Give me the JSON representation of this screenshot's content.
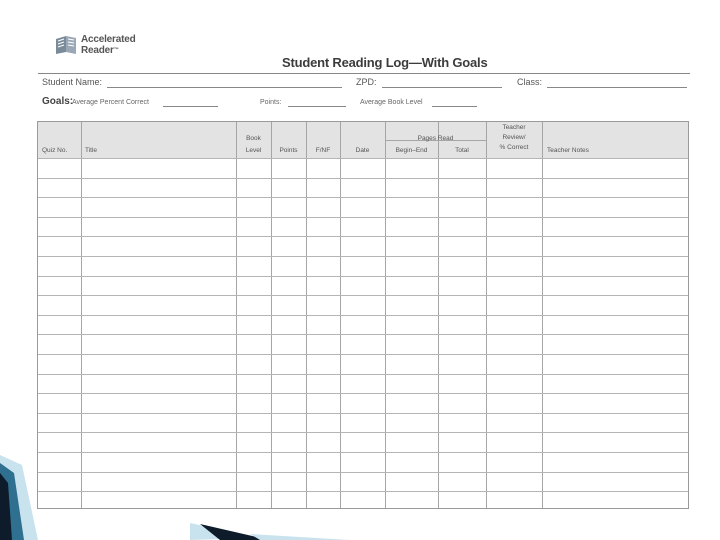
{
  "logo": {
    "line1": "Accelerated",
    "line2": "Reader",
    "tm": "™"
  },
  "title": "Student Reading Log—With Goals",
  "fields": {
    "student_name": "Student Name:",
    "zpd": "ZPD:",
    "class": "Class:"
  },
  "goals": {
    "label": "Goals:",
    "avg_percent": "Average Percent Correct",
    "points": "Points:",
    "avg_book_level": "Average Book Level"
  },
  "table": {
    "headers": {
      "quiz_no": "Quiz No.",
      "title": "Title",
      "book_level_1": "Book",
      "book_level_2": "Level",
      "points": "Points",
      "fnf": "F/NF",
      "date": "Date",
      "pages_read": "Pages Read",
      "begin_end": "Begin–End",
      "total": "Total",
      "teacher_review_1": "Teacher",
      "teacher_review_2": "Review/",
      "teacher_review_3": "% Correct",
      "teacher_notes": "Teacher Notes"
    },
    "row_count": 18
  },
  "colors": {
    "header_bg": "#e3e3e3",
    "grid_line": "#a5a5a5",
    "corner_dark": "#0d1b2a",
    "corner_light": "#c9e3ee"
  }
}
